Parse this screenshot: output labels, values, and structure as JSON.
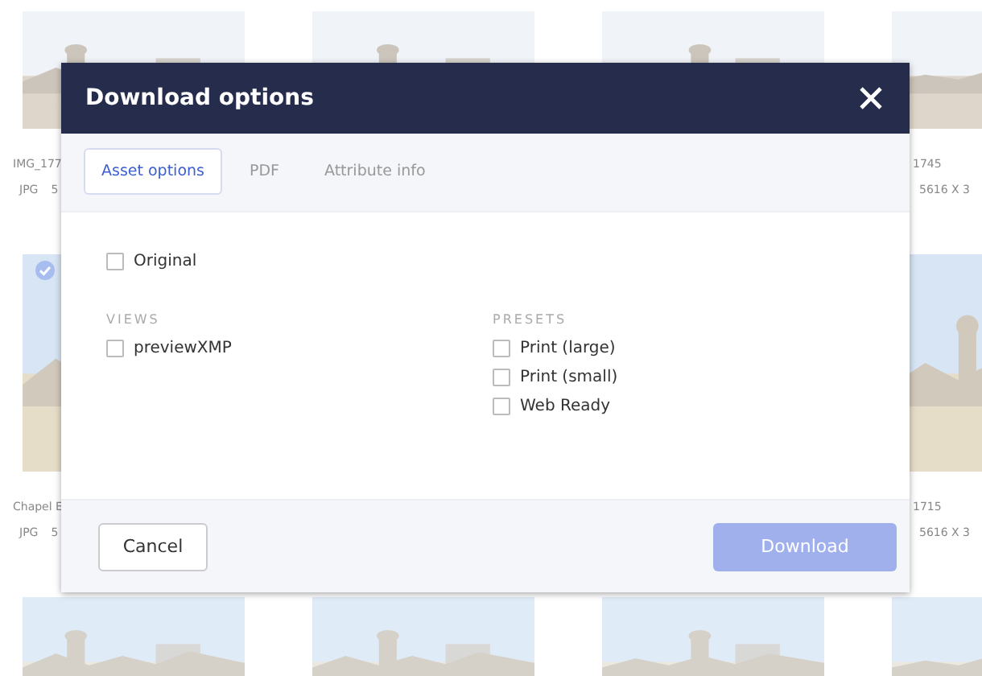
{
  "gallery": {
    "rows": [
      {
        "cards": [
          {
            "selected": false,
            "caption": "IMG_177",
            "meta": [
              "JPG",
              "5"
            ]
          },
          {
            "selected": false
          },
          {
            "selected": false
          },
          {
            "selected": false,
            "caption": "1745",
            "meta": [
              "5616 X 3"
            ]
          }
        ]
      },
      {
        "cards": [
          {
            "selected": true,
            "caption": "Chapel E",
            "meta": [
              "JPG",
              "5"
            ]
          },
          {
            "selected": false,
            "caption": "1715",
            "meta": [
              "5616 X 3"
            ]
          }
        ]
      },
      {
        "cards": [
          {
            "selected": false
          },
          {
            "selected": false
          },
          {
            "selected": false
          },
          {
            "selected": false
          }
        ]
      }
    ]
  },
  "dialog": {
    "title": "Download options",
    "tabs": [
      {
        "label": "Asset options",
        "selected": true
      },
      {
        "label": "PDF",
        "selected": false
      },
      {
        "label": "Attribute info",
        "selected": false
      }
    ],
    "original": {
      "label": "Original",
      "checked": false
    },
    "groups": [
      {
        "heading": "VIEWS",
        "options": [
          {
            "label": "previewXMP",
            "checked": false
          }
        ]
      },
      {
        "heading": "PRESETS",
        "options": [
          {
            "label": "Print (large)",
            "checked": false
          },
          {
            "label": "Print (small)",
            "checked": false
          },
          {
            "label": "Web Ready",
            "checked": false
          }
        ]
      }
    ],
    "buttons": [
      {
        "kind": "secondary",
        "label": "Cancel"
      },
      {
        "kind": "primary",
        "label": "Download",
        "disabled": true
      }
    ]
  }
}
